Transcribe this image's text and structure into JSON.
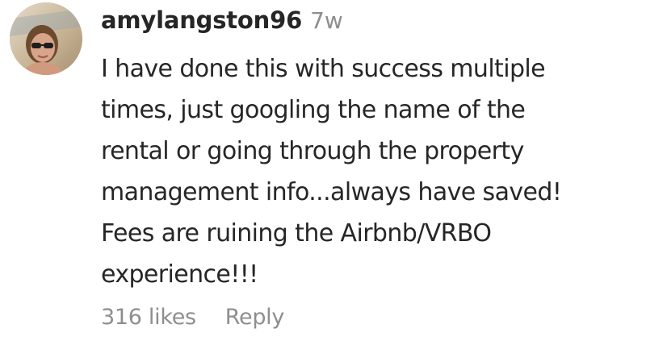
{
  "comment": {
    "avatar_icon": "user-avatar-photo",
    "username": "amylangston96",
    "timestamp": "7w",
    "text": "I have done this with success multiple\ntimes, just googling the name of the\nrental or going through the property\nmanagement info...always have saved!\nFees are ruining the Airbnb/VRBO\nexperience!!!",
    "likes": "316 likes",
    "reply_label": "Reply"
  },
  "colors": {
    "primary_text": "#262626",
    "secondary_text": "#8e8e8e",
    "background": "#ffffff"
  }
}
